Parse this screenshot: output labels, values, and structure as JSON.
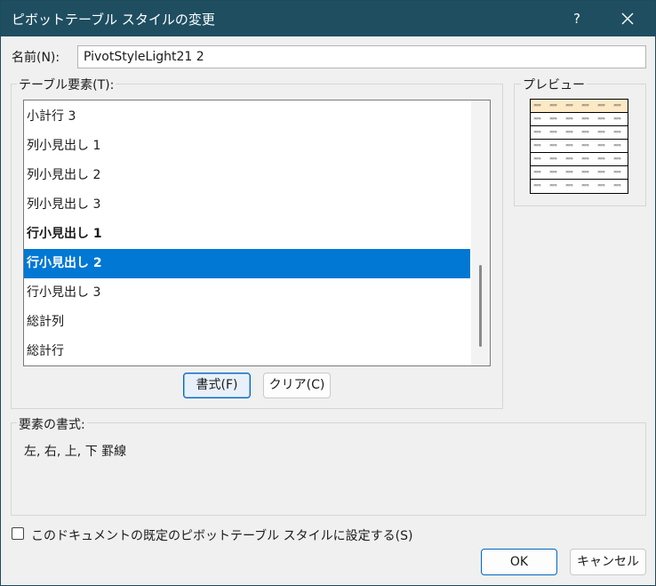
{
  "window": {
    "title": "ピボットテーブル スタイルの変更",
    "help_label": "?",
    "close_icon": "close-icon"
  },
  "name_field": {
    "label": "名前(N):",
    "value": "PivotStyleLight21 2"
  },
  "table_elements": {
    "caption": "テーブル要素(T):",
    "items": [
      {
        "label": "小計行 3",
        "state": "normal"
      },
      {
        "label": "列小見出し 1",
        "state": "normal"
      },
      {
        "label": "列小見出し 2",
        "state": "normal"
      },
      {
        "label": "列小見出し 3",
        "state": "normal"
      },
      {
        "label": "行小見出し 1",
        "state": "bold"
      },
      {
        "label": "行小見出し 2",
        "state": "selected"
      },
      {
        "label": "行小見出し 3",
        "state": "normal"
      },
      {
        "label": "総計列",
        "state": "normal"
      },
      {
        "label": "総計行",
        "state": "normal"
      }
    ],
    "format_button": "書式(F)",
    "clear_button": "クリア(C)"
  },
  "preview": {
    "caption": "プレビュー",
    "header_color": "#fde9c6",
    "cell_glyph": "»»»"
  },
  "element_format": {
    "caption": "要素の書式:",
    "description": "左, 右, 上, 下 罫線"
  },
  "default_checkbox": {
    "label": "このドキュメントの既定のピボットテーブル スタイルに設定する(S)",
    "checked": false
  },
  "footer": {
    "ok_label": "OK",
    "cancel_label": "キャンセル"
  },
  "colors": {
    "titlebar": "#1f4e61",
    "selection": "#0078d4",
    "accent_border": "#0067c0"
  }
}
